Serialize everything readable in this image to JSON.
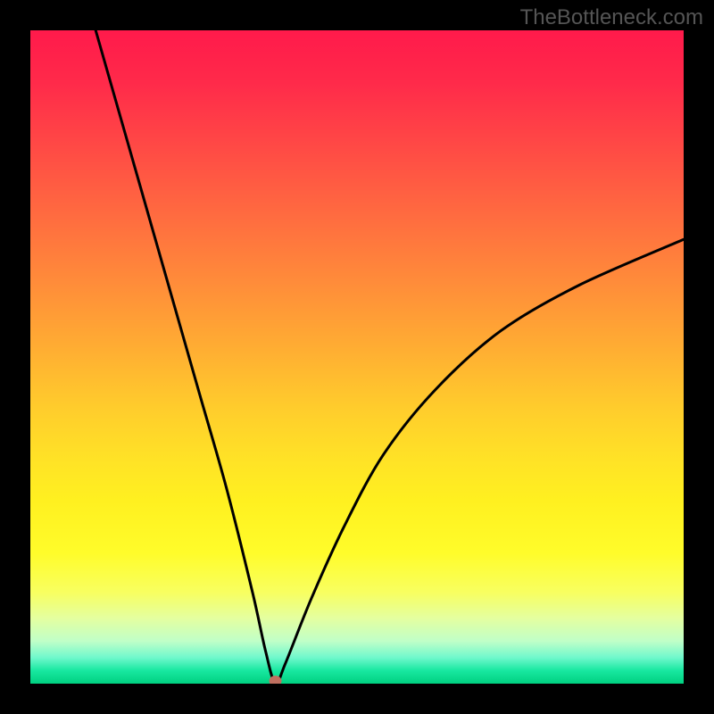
{
  "watermark": "TheBottleneck.com",
  "chart_data": {
    "type": "line",
    "title": "",
    "xlabel": "",
    "ylabel": "",
    "xlim": [
      0,
      100
    ],
    "ylim": [
      0,
      100
    ],
    "series": [
      {
        "name": "bottleneck-curve",
        "x": [
          10,
          14,
          18,
          22,
          26,
          30,
          34,
          36,
          37.5,
          39,
          43,
          48,
          54,
          62,
          72,
          84,
          100
        ],
        "y": [
          100,
          86,
          72,
          58,
          44,
          30,
          14,
          5,
          0,
          3,
          13,
          24,
          35,
          45,
          54,
          61,
          68
        ]
      }
    ],
    "annotations": [
      {
        "name": "minimum-dot",
        "x": 37.5,
        "y": 0
      }
    ],
    "gradient_bands": [
      "red",
      "orange",
      "yellow",
      "pale-yellow",
      "pale-green",
      "green"
    ]
  }
}
